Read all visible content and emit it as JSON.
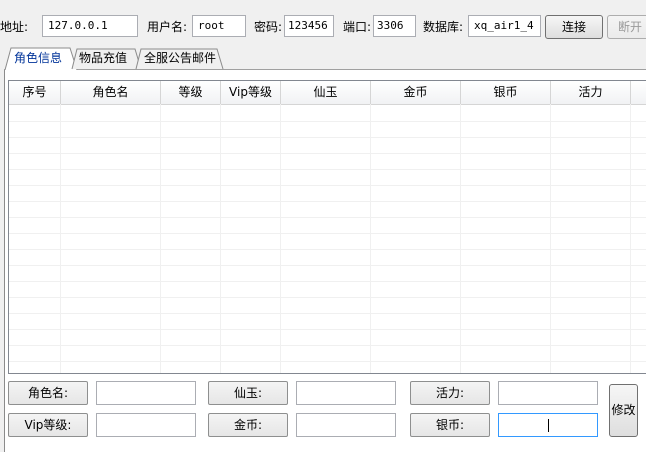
{
  "connection": {
    "host_label": "地址:",
    "host_value": "127.0.0.1",
    "user_label": "用户名:",
    "user_value": "root",
    "password_label": "密码:",
    "password_value": "123456",
    "port_label": "端口:",
    "port_value": "3306",
    "database_label": "数据库:",
    "database_value": "xq_air1_4",
    "connect_label": "连接",
    "disconnect_label": "断开"
  },
  "tabs": [
    {
      "label": "角色信息",
      "active": true
    },
    {
      "label": "物品充值",
      "active": false
    },
    {
      "label": "全服公告邮件",
      "active": false
    }
  ],
  "table": {
    "columns": [
      "序号",
      "角色名",
      "等级",
      "Vip等级",
      "仙玉",
      "金币",
      "银币",
      "活力"
    ]
  },
  "edit": {
    "role_name_label": "角色名:",
    "role_name_value": "",
    "vip_label": "Vip等级:",
    "vip_value": "",
    "xianyu_label": "仙玉:",
    "xianyu_value": "",
    "gold_label": "金币:",
    "gold_value": "",
    "vitality_label": "活力:",
    "vitality_value": "",
    "silver_label": "银币:",
    "silver_value": "",
    "modify_label": "修改"
  },
  "colors": {
    "active_tab_text": "#003399",
    "focus_border": "#3399ff"
  }
}
